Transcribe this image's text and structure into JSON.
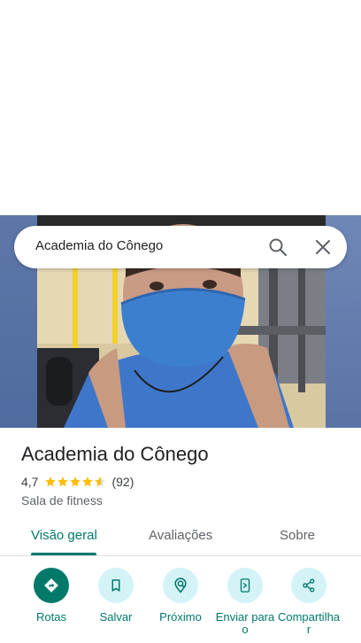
{
  "search": {
    "query": "Academia do Cônego"
  },
  "place": {
    "title": "Academia do Cônego",
    "rating": "4,7",
    "review_count": "(92)",
    "stars_filled": 4.7,
    "category": "Sala de fitness"
  },
  "tabs": [
    {
      "label": "Visão geral",
      "active": true
    },
    {
      "label": "Avaliações",
      "active": false
    },
    {
      "label": "Sobre",
      "active": false
    }
  ],
  "actions": [
    {
      "label": "Rotas",
      "icon": "directions-icon"
    },
    {
      "label": "Salvar",
      "icon": "bookmark-icon"
    },
    {
      "label": "Próximo",
      "icon": "nearby-icon"
    },
    {
      "label": "Enviar para o",
      "icon": "send-to-phone-icon"
    },
    {
      "label": "Compartilhar",
      "icon": "share-icon"
    }
  ],
  "colors": {
    "accent": "#00796b",
    "accent_light": "#d3f3f7",
    "star": "#fbbc04",
    "text_primary": "#202124",
    "text_secondary": "#5f6368"
  }
}
